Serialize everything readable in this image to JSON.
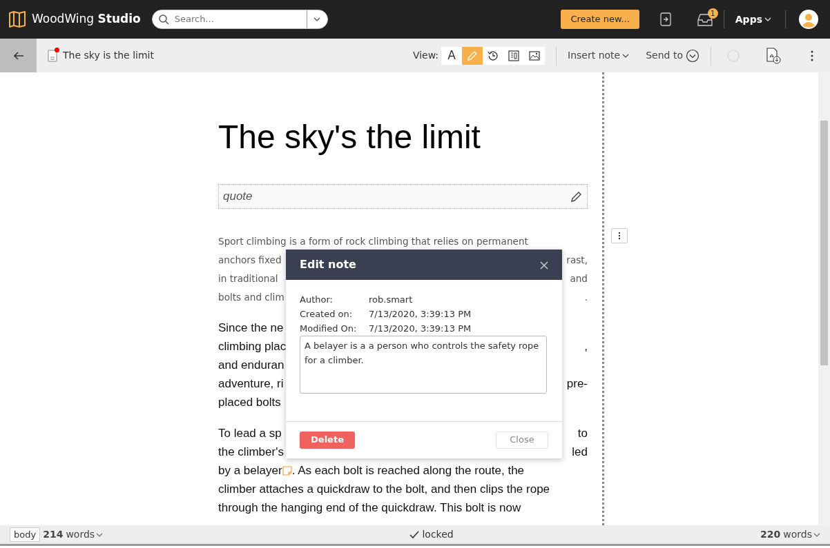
{
  "app": {
    "brand_light": "WoodWing",
    "brand_bold": "Studio",
    "search": {
      "placeholder": "Search..."
    },
    "create_button": "Create new...",
    "inbox_badge": "1",
    "apps_menu": "Apps"
  },
  "toolbar": {
    "document_title": "The sky is the limit",
    "unsaved": true,
    "view_label": "View:",
    "view_modes": [
      {
        "kind": "text",
        "label": "A",
        "selected": false
      },
      {
        "kind": "pencil",
        "selected": true
      },
      {
        "kind": "history",
        "selected": false
      },
      {
        "kind": "layout",
        "selected": false
      },
      {
        "kind": "image",
        "selected": false
      }
    ],
    "insert_note": "Insert note",
    "send_to": "Send to"
  },
  "article": {
    "heading": "The sky's the limit",
    "quote_placeholder": "quote",
    "paragraphs": [
      {
        "kind": "intro",
        "lines": [
          {
            "left": "Sport climbing is a form of rock climbing that relies on permanent"
          },
          {
            "left": "anchors fixed",
            "right": "rast,"
          },
          {
            "left": "in traditional",
            "right": "and"
          },
          {
            "left": "bolts and clim",
            "right": "."
          }
        ]
      },
      {
        "kind": "body",
        "lines": [
          {
            "left": "Since the ne"
          },
          {
            "left": "climbing plac",
            "right": ","
          },
          {
            "left": "and enduran"
          },
          {
            "left": "adventure, ri",
            "right": "pre-"
          },
          {
            "left": "placed bolts"
          }
        ]
      },
      {
        "kind": "body",
        "lines": [
          {
            "left": "To lead a sp",
            "right": "to"
          },
          {
            "left": "the climber's",
            "right": "led"
          },
          {
            "left": "by a belayer",
            "note": true,
            "rest": ". As each bolt is reached along the route, the"
          },
          {
            "left": "climber attaches a quickdraw to the bolt, and then clips the rope"
          },
          {
            "left": "through the hanging end of the quickdraw. This bolt is now"
          }
        ]
      }
    ]
  },
  "dialog": {
    "title": "Edit note",
    "fields": [
      {
        "label": "Author:",
        "value": "rob.smart"
      },
      {
        "label": "Created on:",
        "value": "7/13/2020, 3:39:13 PM"
      },
      {
        "label": "Modified On:",
        "value": "7/13/2020, 3:39:13 PM"
      }
    ],
    "note_text": "A belayer is a a person who controls the safety rope for a climber.",
    "delete_button": "Delete",
    "close_button": "Close"
  },
  "status_bar": {
    "style_tag": "body",
    "word_count": "214",
    "words_label": "words",
    "lock_status": "locked",
    "total_count": "220",
    "total_label": "words"
  }
}
